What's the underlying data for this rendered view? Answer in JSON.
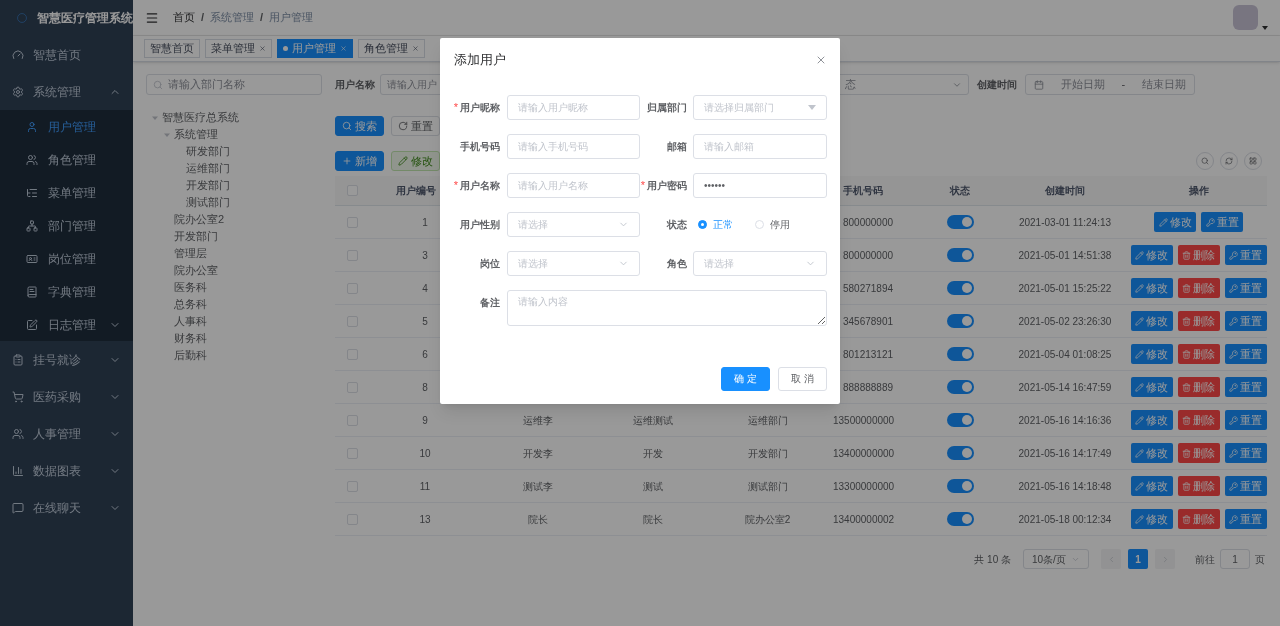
{
  "sidebar": {
    "title": "智慧医疗管理系统",
    "items": [
      {
        "label": "智慧首页",
        "selected": false
      },
      {
        "label": "系统管理",
        "selected": false,
        "expanded": true,
        "children": [
          {
            "label": "用户管理",
            "selected": true
          },
          {
            "label": "角色管理",
            "selected": false
          },
          {
            "label": "菜单管理",
            "selected": false
          },
          {
            "label": "部门管理",
            "selected": false
          },
          {
            "label": "岗位管理",
            "selected": false
          },
          {
            "label": "字典管理",
            "selected": false
          },
          {
            "label": "日志管理",
            "selected": false,
            "expanded": false
          }
        ]
      },
      {
        "label": "挂号就诊",
        "selected": false,
        "expanded": false
      },
      {
        "label": "医药采购",
        "selected": false,
        "expanded": false
      },
      {
        "label": "人事管理",
        "selected": false,
        "expanded": false
      },
      {
        "label": "数据图表",
        "selected": false,
        "expanded": false
      },
      {
        "label": "在线聊天",
        "selected": false,
        "expanded": false
      }
    ]
  },
  "breadcrumb": {
    "separator": "/",
    "items": [
      "首页",
      "系统管理",
      "用户管理"
    ]
  },
  "tabs": [
    {
      "label": "智慧首页",
      "selected": false,
      "closable": false
    },
    {
      "label": "菜单管理",
      "selected": false,
      "closable": true
    },
    {
      "label": "用户管理",
      "selected": true,
      "closable": true
    },
    {
      "label": "角色管理",
      "selected": false,
      "closable": true
    }
  ],
  "dept_tree": {
    "placeholder": "请输入部门名称",
    "nodes": [
      {
        "label": "智慧医疗总系统",
        "expanded": true,
        "children": [
          {
            "label": "系统管理",
            "expanded": true,
            "children": [
              {
                "label": "研发部门"
              },
              {
                "label": "运维部门"
              },
              {
                "label": "开发部门"
              },
              {
                "label": "测试部门"
              }
            ]
          },
          {
            "label": "院办公室2"
          },
          {
            "label": "开发部门"
          },
          {
            "label": "管理层"
          },
          {
            "label": "院办公室"
          },
          {
            "label": "医务科"
          },
          {
            "label": "总务科"
          },
          {
            "label": "人事科"
          },
          {
            "label": "财务科"
          },
          {
            "label": "后勤科"
          }
        ]
      }
    ]
  },
  "search_form": {
    "name_label": "用户名称",
    "name_placeholder": "请输入用户",
    "status_placeholder": "态",
    "date_label": "创建时间",
    "date_start": "开始日期",
    "date_separator": "-",
    "date_end": "结束日期"
  },
  "actions": [
    {
      "label": "搜索",
      "kind": "search",
      "disabled": false
    },
    {
      "label": "重置",
      "kind": "reset",
      "disabled": false
    }
  ],
  "toolbar": [
    {
      "label": "新增",
      "kind": "add",
      "disabled": false
    },
    {
      "label": "修改",
      "kind": "edit",
      "disabled": true
    }
  ],
  "table": {
    "header_checked": false,
    "columns": [
      {
        "label": "用户编号"
      },
      {
        "label": "手机号码"
      },
      {
        "label": "状态"
      },
      {
        "label": "创建时间"
      },
      {
        "label": "操作"
      }
    ],
    "rows": [
      {
        "checked": false,
        "id": "1",
        "phone": "800000000",
        "on": true,
        "time": "2021-03-01 11:24:13",
        "actions": [
          {
            "label": "修改",
            "kind": "edit"
          },
          {
            "label": "重置",
            "kind": "reset"
          }
        ]
      },
      {
        "checked": false,
        "id": "3",
        "phone": "800000000",
        "on": true,
        "time": "2021-05-01 14:51:38",
        "actions": [
          {
            "label": "修改",
            "kind": "edit"
          },
          {
            "label": "删除",
            "kind": "delete"
          },
          {
            "label": "重置",
            "kind": "reset"
          }
        ]
      },
      {
        "checked": false,
        "id": "4",
        "phone": "580271894",
        "on": true,
        "time": "2021-05-01 15:25:22",
        "actions": [
          {
            "label": "修改",
            "kind": "edit"
          },
          {
            "label": "删除",
            "kind": "delete"
          },
          {
            "label": "重置",
            "kind": "reset"
          }
        ]
      },
      {
        "checked": false,
        "id": "5",
        "phone": "345678901",
        "on": true,
        "time": "2021-05-02 23:26:30",
        "actions": [
          {
            "label": "修改",
            "kind": "edit"
          },
          {
            "label": "删除",
            "kind": "delete"
          },
          {
            "label": "重置",
            "kind": "reset"
          }
        ]
      },
      {
        "checked": false,
        "id": "6",
        "phone": "801213121",
        "on": true,
        "time": "2021-05-04 01:08:25",
        "actions": [
          {
            "label": "修改",
            "kind": "edit"
          },
          {
            "label": "删除",
            "kind": "delete"
          },
          {
            "label": "重置",
            "kind": "reset"
          }
        ]
      },
      {
        "checked": false,
        "id": "8",
        "phone": "888888889",
        "on": true,
        "time": "2021-05-14 16:47:59",
        "actions": [
          {
            "label": "修改",
            "kind": "edit"
          },
          {
            "label": "删除",
            "kind": "delete"
          },
          {
            "label": "重置",
            "kind": "reset"
          }
        ]
      },
      {
        "checked": false,
        "id": "9",
        "column_3": "运维李",
        "column_4": "运维测试",
        "column_5": "运维部门",
        "phone": "13500000000",
        "on": true,
        "time": "2021-05-16 14:16:36",
        "actions": [
          {
            "label": "修改",
            "kind": "edit"
          },
          {
            "label": "删除",
            "kind": "delete"
          },
          {
            "label": "重置",
            "kind": "reset"
          }
        ]
      },
      {
        "checked": false,
        "id": "10",
        "column_3": "开发李",
        "column_4": "开发",
        "column_5": "开发部门",
        "phone": "13400000000",
        "on": true,
        "time": "2021-05-16 14:17:49",
        "actions": [
          {
            "label": "修改",
            "kind": "edit"
          },
          {
            "label": "删除",
            "kind": "delete"
          },
          {
            "label": "重置",
            "kind": "reset"
          }
        ]
      },
      {
        "checked": false,
        "id": "11",
        "column_3": "测试李",
        "column_4": "测试",
        "column_5": "测试部门",
        "phone": "13300000000",
        "on": true,
        "time": "2021-05-16 14:18:48",
        "actions": [
          {
            "label": "修改",
            "kind": "edit"
          },
          {
            "label": "删除",
            "kind": "delete"
          },
          {
            "label": "重置",
            "kind": "reset"
          }
        ]
      },
      {
        "checked": false,
        "id": "13",
        "column_3": "院长",
        "column_4": "院长",
        "column_5": "院办公室2",
        "phone": "13400000002",
        "on": true,
        "time": "2021-05-18 00:12:34",
        "actions": [
          {
            "label": "修改",
            "kind": "edit"
          },
          {
            "label": "删除",
            "kind": "delete"
          },
          {
            "label": "重置",
            "kind": "reset"
          }
        ]
      }
    ]
  },
  "pagination": {
    "total": "共 10 条",
    "page_size": "10条/页",
    "pages": [
      {
        "label": "1",
        "selected": true
      }
    ],
    "goto_label": "前往",
    "goto_value": "1",
    "goto_suffix": "页"
  },
  "modal": {
    "title": "添加用户",
    "required_mark": "*",
    "fields": [
      {
        "kind": "input",
        "label": "用户昵称",
        "required": true,
        "placeholder": "请输入用户昵称"
      },
      {
        "kind": "treeselect",
        "label": "归属部门",
        "required": false,
        "placeholder": "请选择归属部门"
      },
      {
        "kind": "input",
        "label": "手机号码",
        "required": false,
        "placeholder": "请输入手机号码"
      },
      {
        "kind": "input",
        "label": "邮箱",
        "required": false,
        "placeholder": "请输入邮箱"
      },
      {
        "kind": "input",
        "label": "用户名称",
        "required": true,
        "placeholder": "请输入用户名称"
      },
      {
        "kind": "input",
        "label": "用户密码",
        "required": true,
        "value": "••••••"
      },
      {
        "kind": "select",
        "label": "用户性别",
        "required": false,
        "placeholder": "请选择"
      },
      {
        "kind": "radio",
        "label": "状态",
        "required": false,
        "options": [
          {
            "label": "正常",
            "selected": true
          },
          {
            "label": "停用",
            "selected": false
          }
        ]
      },
      {
        "kind": "select",
        "label": "岗位",
        "required": false,
        "placeholder": "请选择"
      },
      {
        "kind": "select",
        "label": "角色",
        "required": false,
        "placeholder": "请选择"
      },
      {
        "kind": "textarea",
        "label": "备注",
        "required": false,
        "placeholder": "请输入内容"
      }
    ],
    "buttons": [
      {
        "label": "确 定",
        "kind": "primary"
      },
      {
        "label": "取 消",
        "kind": "default"
      }
    ]
  }
}
